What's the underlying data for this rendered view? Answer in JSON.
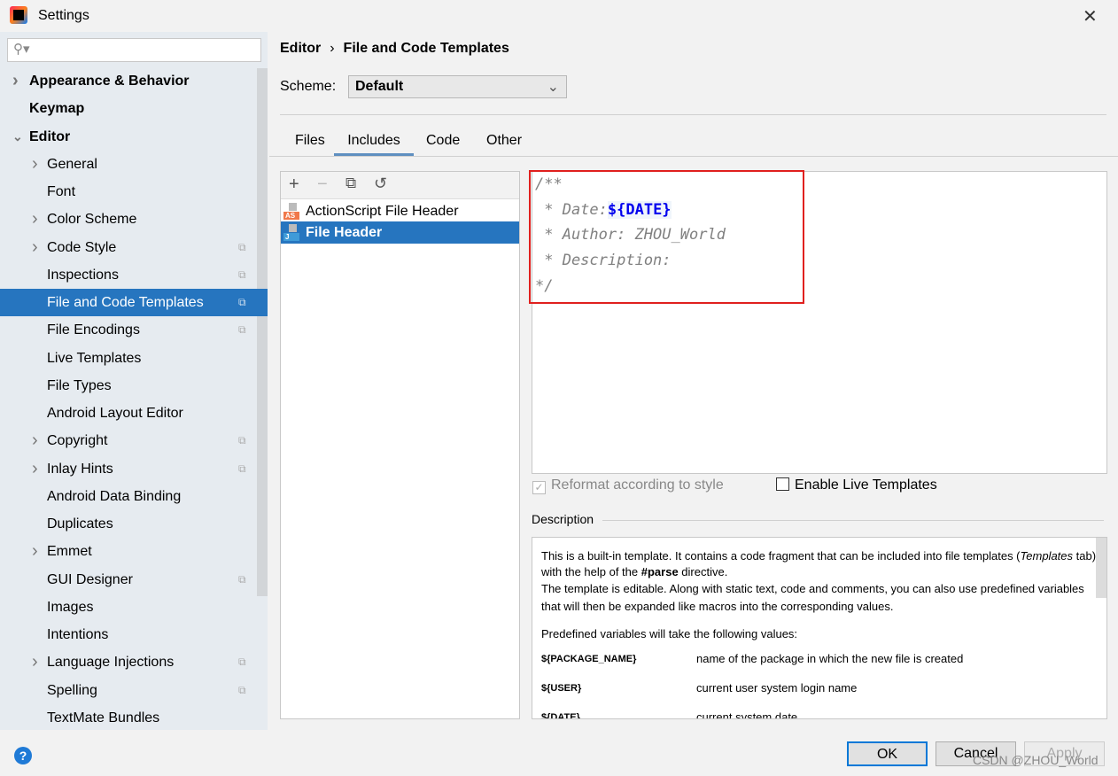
{
  "window": {
    "title": "Settings"
  },
  "search": {
    "placeholder": ""
  },
  "sidebar": {
    "items": [
      {
        "label": "Appearance & Behavior",
        "expand": "collapsed",
        "bold": true
      },
      {
        "label": "Keymap",
        "bold": true
      },
      {
        "label": "Editor",
        "expand": "expanded",
        "bold": true
      },
      {
        "label": "General",
        "expand": "collapsed"
      },
      {
        "label": "Font"
      },
      {
        "label": "Color Scheme",
        "expand": "collapsed"
      },
      {
        "label": "Code Style",
        "expand": "collapsed",
        "copy": true
      },
      {
        "label": "Inspections",
        "copy": true
      },
      {
        "label": "File and Code Templates",
        "copy": true,
        "selected": true
      },
      {
        "label": "File Encodings",
        "copy": true
      },
      {
        "label": "Live Templates"
      },
      {
        "label": "File Types"
      },
      {
        "label": "Android Layout Editor"
      },
      {
        "label": "Copyright",
        "expand": "collapsed",
        "copy": true
      },
      {
        "label": "Inlay Hints",
        "expand": "collapsed",
        "copy": true
      },
      {
        "label": "Android Data Binding"
      },
      {
        "label": "Duplicates"
      },
      {
        "label": "Emmet",
        "expand": "collapsed"
      },
      {
        "label": "GUI Designer",
        "copy": true
      },
      {
        "label": "Images"
      },
      {
        "label": "Intentions"
      },
      {
        "label": "Language Injections",
        "expand": "collapsed",
        "copy": true
      },
      {
        "label": "Spelling",
        "copy": true
      },
      {
        "label": "TextMate Bundles"
      }
    ]
  },
  "breadcrumb": {
    "parent": "Editor",
    "current": "File and Code Templates"
  },
  "scheme": {
    "label": "Scheme:",
    "value": "Default"
  },
  "tabs": [
    {
      "label": "Files"
    },
    {
      "label": "Includes",
      "active": true
    },
    {
      "label": "Code"
    },
    {
      "label": "Other"
    }
  ],
  "templates": [
    {
      "label": "ActionScript File Header",
      "badge": "AS",
      "color": "#f0784a"
    },
    {
      "label": "File Header",
      "badge": "J",
      "color": "#3f9bd8",
      "selected": true
    }
  ],
  "editor": {
    "line1": "/**",
    "line2_prefix": " * Date:",
    "line2_var": "${DATE}",
    "line3": " * Author: ZHOU_World",
    "line4": " * Description:",
    "line5": "*/"
  },
  "options": {
    "reformat": "Reformat according to style",
    "reformat_checked": true,
    "reformat_disabled": true,
    "live": "Enable Live Templates",
    "live_checked": false
  },
  "description": {
    "label": "Description",
    "p1a": "This is a built-in template. It contains a code fragment that can be included into file templates (",
    "p1i": "Templates",
    "p1b": " tab) with the help of the ",
    "p1bold": "#parse",
    "p1c": " directive.",
    "p2": "The template is editable. Along with static text, code and comments, you can also use predefined variables that will then be expanded like macros into the corresponding values.",
    "p3": "Predefined variables will take the following values:",
    "vars": [
      {
        "name": "${PACKAGE_NAME}",
        "desc": "name of the package in which the new file is created"
      },
      {
        "name": "${USER}",
        "desc": "current user system login name"
      },
      {
        "name": "${DATE}",
        "desc": "current system date"
      }
    ]
  },
  "buttons": {
    "ok": "OK",
    "cancel": "Cancel",
    "apply": "Apply"
  },
  "watermark": "CSDN @ZHOU_World",
  "colors": {
    "selection": "#2675bf",
    "highlight_box": "#e0201e",
    "variable": "#0000ee"
  }
}
